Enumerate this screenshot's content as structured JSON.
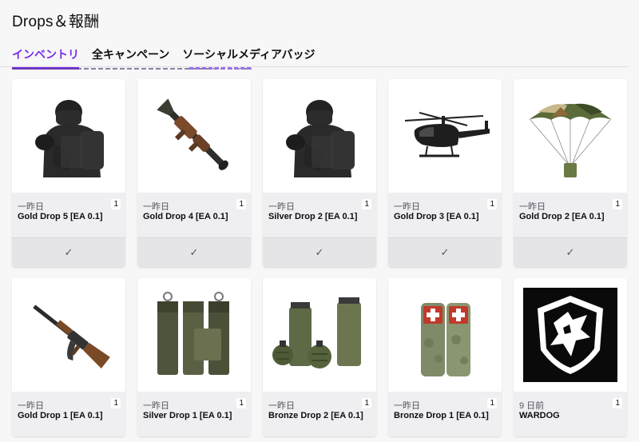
{
  "page": {
    "title": "Drops＆報酬"
  },
  "tabs": [
    {
      "label": "インベントリ",
      "active": true
    },
    {
      "label": "全キャンペーン",
      "active": false
    },
    {
      "label": "ソーシャルメディアバッジ",
      "active": false
    }
  ],
  "claim_icon": "✓",
  "cards": [
    {
      "date": "一昨日",
      "count": "1",
      "name": "Gold Drop 5 [EA 0.1]",
      "icon": "soldier-icon",
      "claimed": true
    },
    {
      "date": "一昨日",
      "count": "1",
      "name": "Gold Drop 4 [EA 0.1]",
      "icon": "rpg-launcher-icon",
      "claimed": true
    },
    {
      "date": "一昨日",
      "count": "1",
      "name": "Silver Drop 2 [EA 0.1]",
      "icon": "soldier-icon",
      "claimed": true
    },
    {
      "date": "一昨日",
      "count": "1",
      "name": "Gold Drop 3 [EA 0.1]",
      "icon": "helicopter-icon",
      "claimed": true
    },
    {
      "date": "一昨日",
      "count": "1",
      "name": "Gold Drop 2 [EA 0.1]",
      "icon": "parachute-icon",
      "claimed": true
    },
    {
      "date": "一昨日",
      "count": "1",
      "name": "Gold Drop 1 [EA 0.1]",
      "icon": "rifle-icon",
      "claimed": true
    },
    {
      "date": "一昨日",
      "count": "1",
      "name": "Silver Drop 1 [EA 0.1]",
      "icon": "ammo-pouches-icon",
      "claimed": true
    },
    {
      "date": "一昨日",
      "count": "1",
      "name": "Bronze Drop 2 [EA 0.1]",
      "icon": "grenades-icon",
      "claimed": true
    },
    {
      "date": "一昨日",
      "count": "1",
      "name": "Bronze Drop 1 [EA 0.1]",
      "icon": "medkit-pouches-icon",
      "claimed": true
    },
    {
      "date": "9 日前",
      "count": "1",
      "name": "WARDOG",
      "icon": "wardog-logo-icon",
      "claimed": true
    }
  ]
}
